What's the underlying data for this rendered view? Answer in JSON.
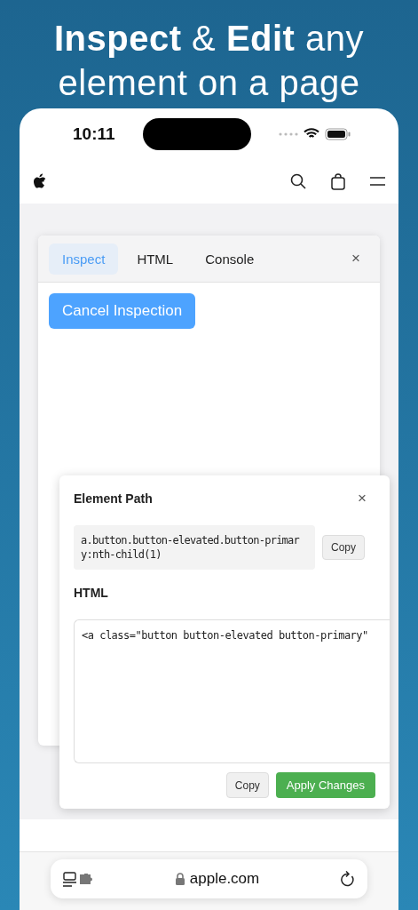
{
  "headline": "**Inspect** & **Edit** any element on a page",
  "status_bar": {
    "time": "10:11"
  },
  "inspector": {
    "tabs": [
      {
        "label": "Inspect",
        "selected": true
      },
      {
        "label": "HTML",
        "selected": false
      },
      {
        "label": "Console",
        "selected": false
      }
    ],
    "close": "×",
    "action_button": "Cancel Inspection"
  },
  "element_dialog": {
    "title": "Element Path",
    "close": "×",
    "path": "a.button.button-elevated.button-primary:nth-child(1)",
    "path_copy": "Copy",
    "html_label": "HTML",
    "html_value": "<a class=\"button button-elevated button-primary\"",
    "buttons": [
      {
        "label": "Copy",
        "kind": "secondary"
      },
      {
        "label": "Apply Changes",
        "kind": "primary"
      }
    ]
  },
  "address_bar": {
    "url": "apple.com"
  }
}
